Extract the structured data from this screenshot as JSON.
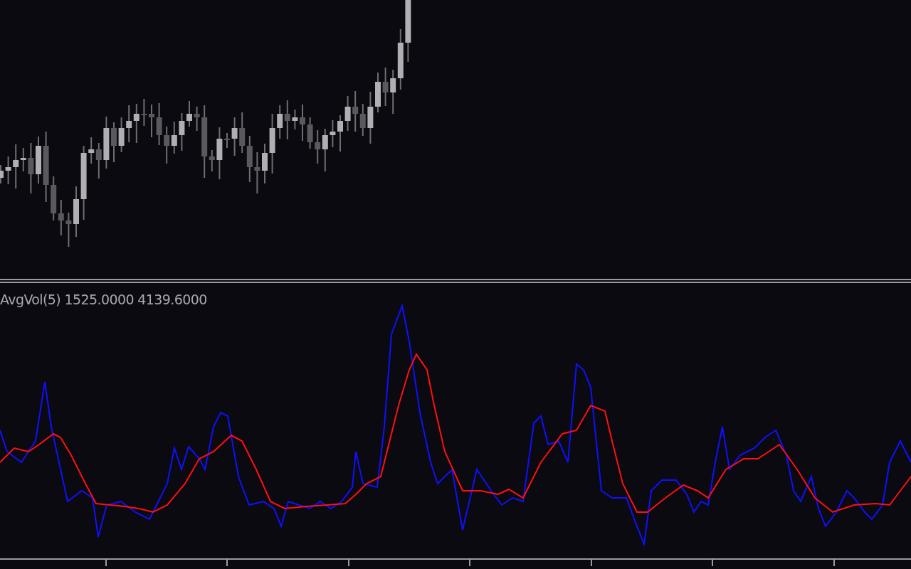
{
  "indicator_pane": {
    "label": "AvgVol(5) 1525.0000 4139.6000"
  }
}
